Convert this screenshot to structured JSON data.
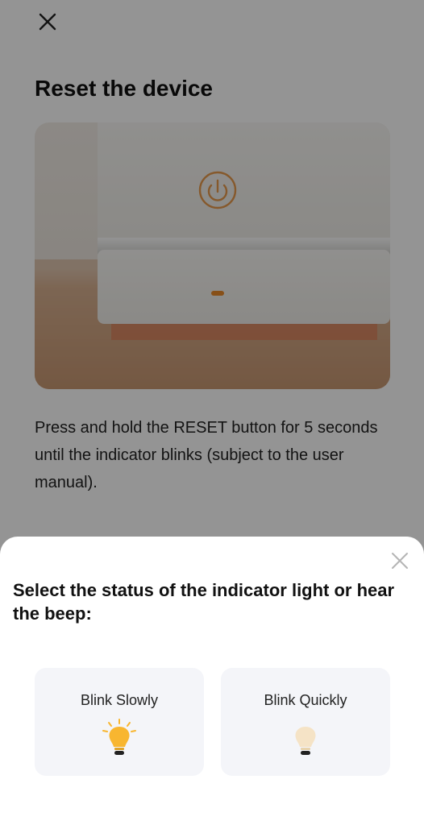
{
  "page": {
    "title": "Reset the device",
    "description": "Press and hold the RESET button for 5 seconds until the indicator blinks (subject to the user manual).",
    "close_icon": "close-icon"
  },
  "sheet": {
    "title": "Select the status of the indicator light or hear the beep:",
    "close_icon": "close-icon",
    "options": [
      {
        "label": "Blink Slowly",
        "icon": "bulb-lit-icon"
      },
      {
        "label": "Blink Quickly",
        "icon": "bulb-dim-icon"
      }
    ]
  },
  "colors": {
    "overlay": "rgba(0,0,0,0.42)",
    "option_bg": "#f4f5f9",
    "bulb_lit": "#f8b630",
    "bulb_dim": "#f5e3c6",
    "indicator_orange": "#e88a2a"
  }
}
